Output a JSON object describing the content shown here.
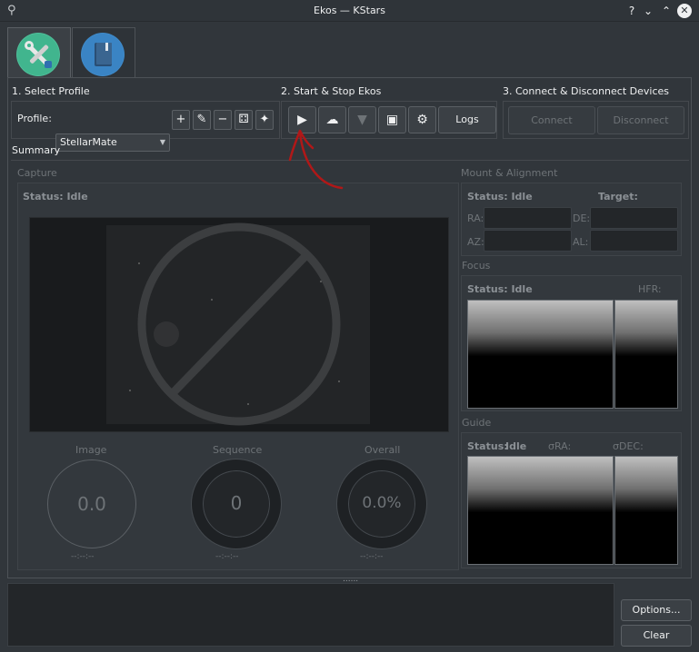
{
  "window": {
    "title": "Ekos — KStars"
  },
  "profile": {
    "section_title": "1. Select Profile",
    "label": "Profile:",
    "selected": "StellarMate"
  },
  "start_stop": {
    "section_title": "2. Start & Stop Ekos",
    "logs_label": "Logs"
  },
  "connect": {
    "section_title": "3. Connect & Disconnect Devices",
    "connect_label": "Connect",
    "disconnect_label": "Disconnect"
  },
  "summary": {
    "title": "Summary",
    "capture": {
      "title": "Capture",
      "status": "Status: Idle",
      "progress": [
        {
          "label": "Image",
          "value": "0.0",
          "time": "--:--:--"
        },
        {
          "label": "Sequence",
          "value": "0",
          "time": "--:--:--"
        },
        {
          "label": "Overall",
          "value": "0.0%",
          "time": "--:--:--"
        }
      ]
    },
    "mount": {
      "title": "Mount & Alignment",
      "status": "Status: Idle",
      "target_label": "Target:",
      "ra_label": "RA:",
      "de_label": "DE:",
      "az_label": "AZ:",
      "al_label": "AL:"
    },
    "focus": {
      "title": "Focus",
      "status": "Status: Idle",
      "hfr_label": "HFR:"
    },
    "guide": {
      "title": "Guide",
      "status_label": "Status:",
      "status_value": "Idle",
      "sigma_ra_label": "σRA:",
      "sigma_dec_label": "σDEC:"
    }
  },
  "footer": {
    "options_label": "Options...",
    "clear_label": "Clear"
  },
  "colors": {
    "accent": "#3daee9",
    "annotation_arrow": "#b01818"
  }
}
